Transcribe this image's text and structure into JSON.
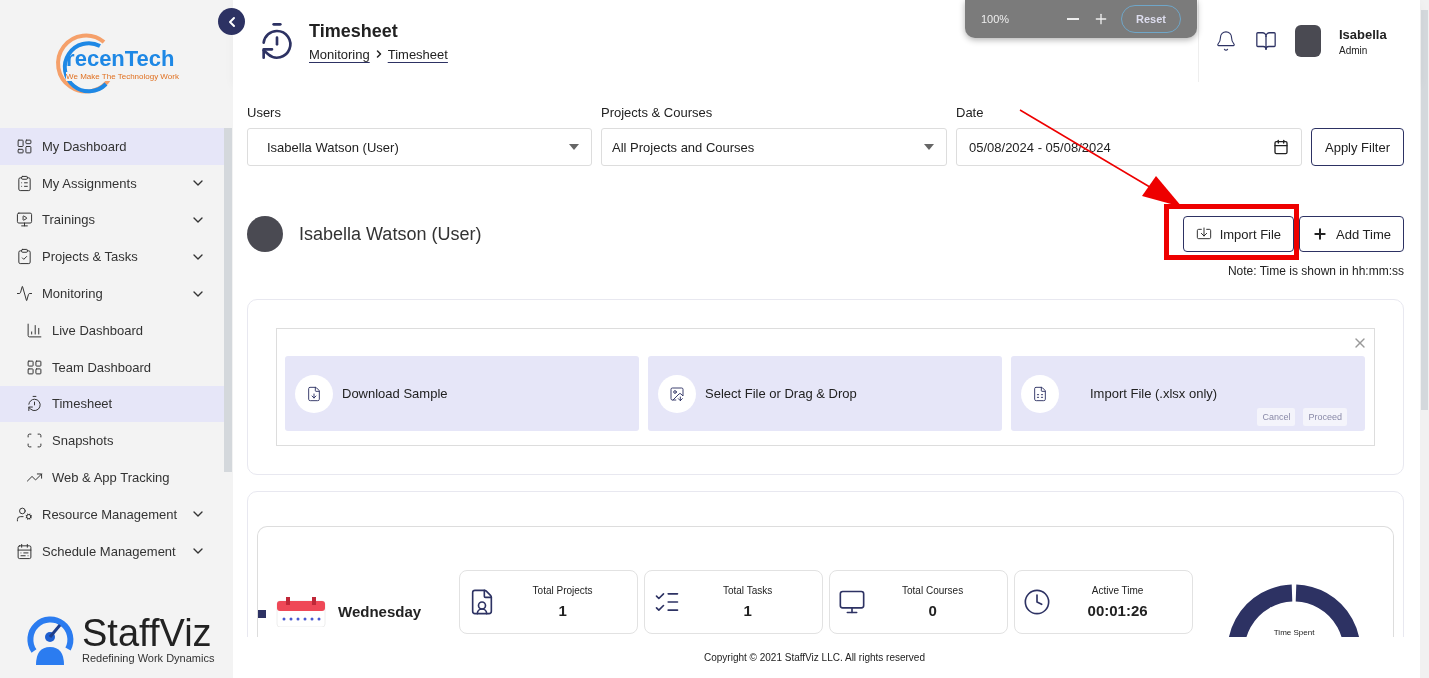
{
  "sidebar": {
    "logo": {
      "name": "recenTech",
      "tagline": "We Make The Technology Work"
    },
    "items": [
      {
        "label": "My Dashboard",
        "selected": true,
        "expandable": false
      },
      {
        "label": "My Assignments",
        "selected": false,
        "expandable": true
      },
      {
        "label": "Trainings",
        "selected": false,
        "expandable": true
      },
      {
        "label": "Projects & Tasks",
        "selected": false,
        "expandable": true
      },
      {
        "label": "Monitoring",
        "selected": false,
        "expandable": true,
        "children": [
          {
            "label": "Live Dashboard",
            "selected": false
          },
          {
            "label": "Team Dashboard",
            "selected": false
          },
          {
            "label": "Timesheet",
            "selected": true
          },
          {
            "label": "Snapshots",
            "selected": false
          },
          {
            "label": "Web & App Tracking",
            "selected": false
          }
        ]
      },
      {
        "label": "Resource Management",
        "selected": false,
        "expandable": true
      },
      {
        "label": "Schedule Management",
        "selected": false,
        "expandable": true
      }
    ],
    "brand": {
      "name": "StaffViz",
      "tagline": "Redefining Work Dynamics"
    }
  },
  "header": {
    "title": "Timesheet",
    "breadcrumb": [
      "Monitoring",
      "Timesheet"
    ],
    "zoom": {
      "level_text": "100%",
      "reset": "Reset"
    },
    "user": {
      "name": "Isabella",
      "role": "Admin"
    }
  },
  "filters": [
    {
      "label": "Users",
      "value": "Isabella Watson (User)",
      "kind": "select"
    },
    {
      "label": "Projects & Courses",
      "value": "All Projects and Courses",
      "kind": "select"
    },
    {
      "label": "Date",
      "value": "05/08/2024 - 05/08/2024",
      "kind": "date"
    }
  ],
  "apply_button": "Apply Filter",
  "user_row": {
    "name": "Isabella Watson (User)",
    "import_button": "Import File",
    "add_button": "Add Time",
    "note": "Note: Time is shown in hh:mm:ss"
  },
  "import_panel": {
    "steps": [
      "Download Sample",
      "Select File or Drag & Drop",
      "Import File (.xlsx only)"
    ],
    "actions": [
      {
        "label": "Cancel",
        "disabled": true
      },
      {
        "label": "Proceed",
        "disabled": true
      }
    ]
  },
  "summary": {
    "day": "Wednesday",
    "stats": [
      {
        "label": "Total Projects",
        "value": "1"
      },
      {
        "label": "Total Tasks",
        "value": "1"
      },
      {
        "label": "Total Courses",
        "value": "0"
      },
      {
        "label": "Active Time",
        "value": "00:01:26"
      }
    ],
    "donut_label": "Time Spent"
  },
  "footer": "Copyright © 2021 StaffViz LLC. All rights reserved"
}
